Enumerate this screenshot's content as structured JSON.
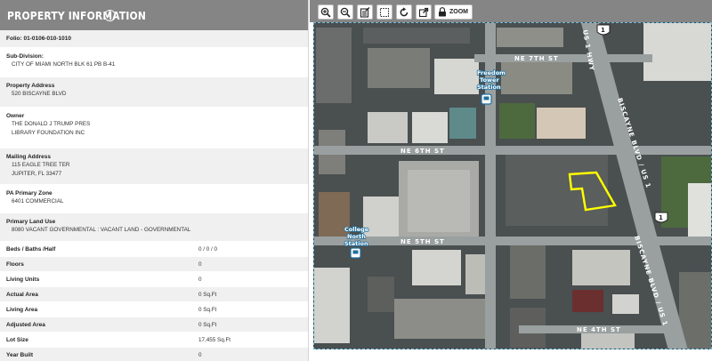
{
  "panel": {
    "title": "PROPERTY INFORMATION",
    "folio": "Folio:  01-0106-010-1010",
    "subdivision_label": "Sub-Division:",
    "subdivision_value": "CITY OF MIAMI NORTH BLK 61 PB B-41",
    "property_address_label": "Property Address",
    "property_address_value": "520 BISCAYNE BLVD",
    "owner_label": "Owner",
    "owner_line1": "THE DONALD J TRUMP PRES",
    "owner_line2": "LIBRARY FOUNDATION INC",
    "mailing_label": "Mailing Address",
    "mailing_line1": "115 EAGLE TREE TER",
    "mailing_line2": "JUPITER, FL 33477",
    "zone_label": "PA Primary Zone",
    "zone_value": "6401 COMMERCIAL",
    "land_use_label": "Primary Land Use",
    "land_use_value": "8080 VACANT GOVERNMENTAL : VACANT LAND - GOVERNMENTAL",
    "beds_label": "Beds / Baths /Half",
    "beds_value": "0 / 0 / 0",
    "floors_label": "Floors",
    "floors_value": "0",
    "living_units_label": "Living Units",
    "living_units_value": "0",
    "actual_area_label": "Actual Area",
    "actual_area_value": "0 Sq.Ft",
    "living_area_label": "Living Area",
    "living_area_value": "0 Sq.Ft",
    "adjusted_area_label": "Adjusted Area",
    "adjusted_area_value": "0 Sq.Ft",
    "lot_size_label": "Lot Size",
    "lot_size_value": "17,455 Sq.Ft",
    "year_built_label": "Year Built",
    "year_built_value": "0"
  },
  "toolbar": {
    "zoom_label": "ZOOM",
    "icons": [
      "zoom-in-icon",
      "zoom-out-icon",
      "layer-icon",
      "select-box-icon",
      "refresh-icon",
      "external-link-icon",
      "lock-icon"
    ]
  },
  "map": {
    "streets": {
      "ne_7th": "NE 7TH ST",
      "ne_6th": "NE 6TH ST",
      "ne_5th": "NE 5TH ST",
      "ne_4th": "NE 4TH ST",
      "biscayne_north": "BISCAYNE BLVD / US 1",
      "biscayne_south": "BISCAYNE BLVD / US 1",
      "us1_hwy": "US 1 HWY"
    },
    "stations": {
      "freedom_line1": "Freedom",
      "freedom_line2": "Tower",
      "freedom_line3": "Station",
      "college_line1": "College",
      "college_line2": "North",
      "college_line3": "Station"
    },
    "shields": {
      "shield_top": "1",
      "shield_right": "1"
    },
    "highlight_color": "#ffff00"
  }
}
